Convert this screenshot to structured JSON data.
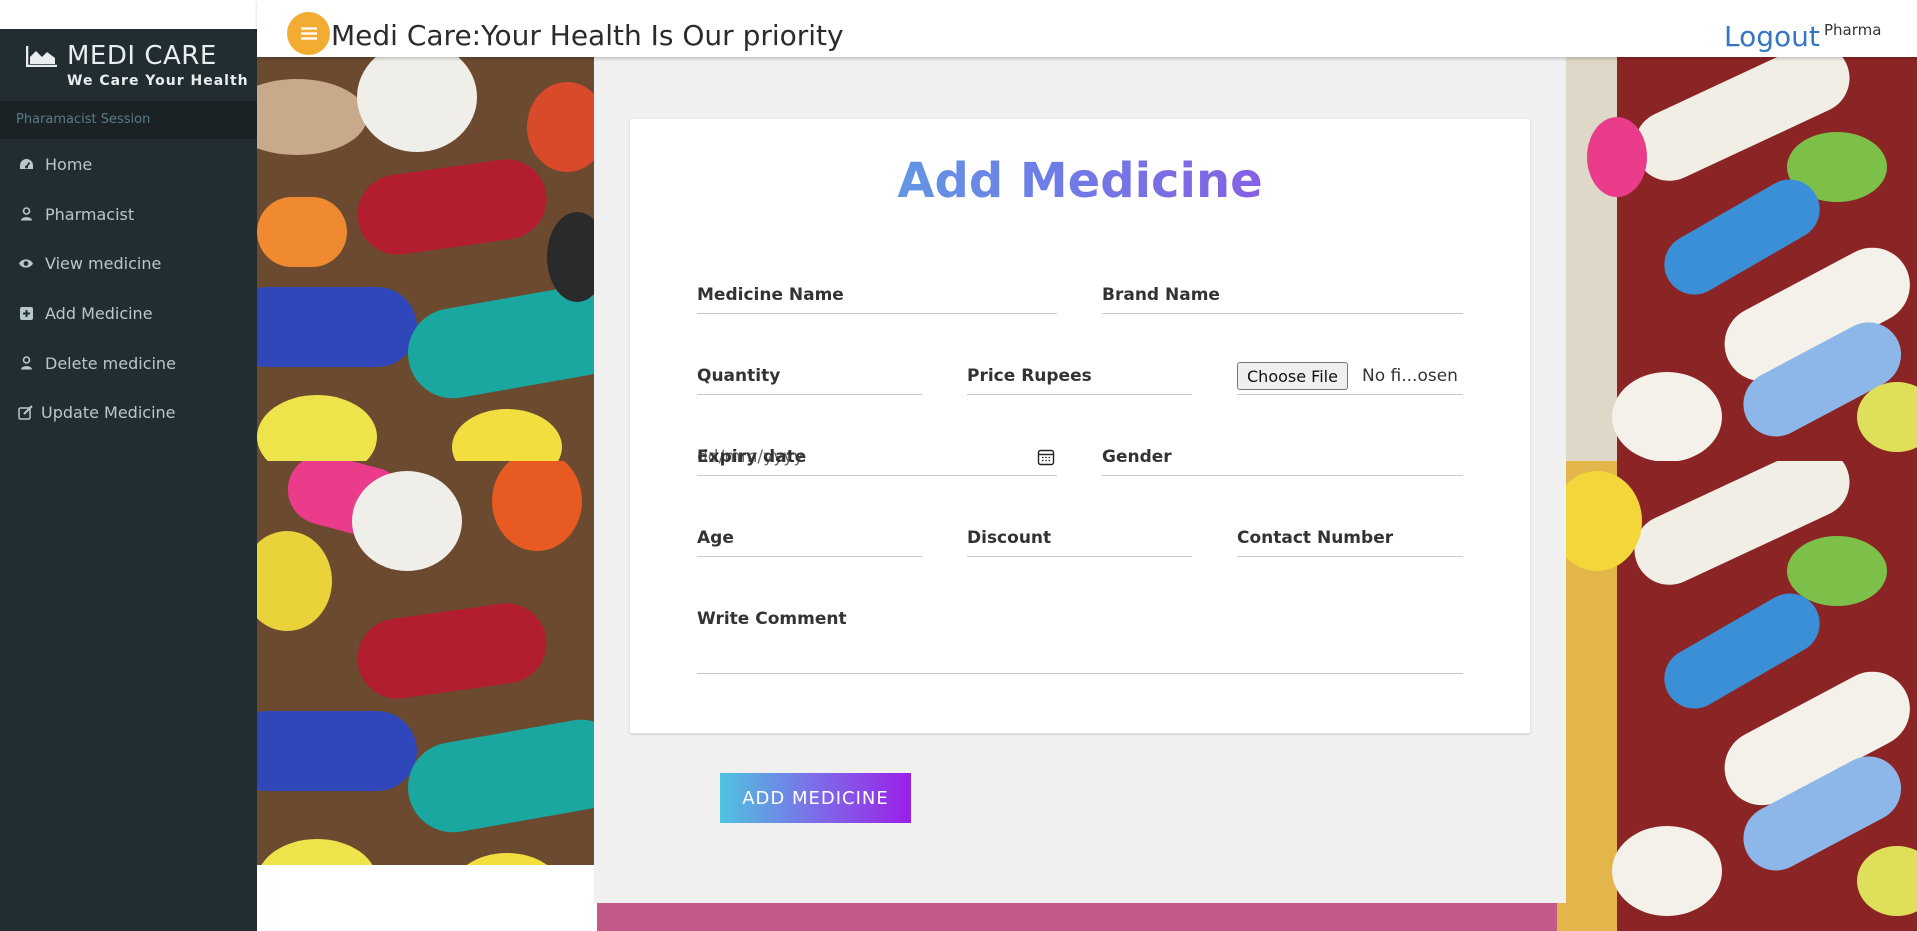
{
  "brand": {
    "name": "MEDI CARE",
    "tagline": "We Care Your Health"
  },
  "sidebar": {
    "session_label": "Pharamacist Session",
    "items": [
      {
        "label": "Home",
        "icon": "dashboard-icon"
      },
      {
        "label": "Pharmacist",
        "icon": "user-icon"
      },
      {
        "label": "View medicine",
        "icon": "eye-icon"
      },
      {
        "label": "Add Medicine",
        "icon": "plus-square-icon"
      },
      {
        "label": "Delete medicine",
        "icon": "user-icon"
      },
      {
        "label": "Update Medicine",
        "icon": "edit-icon"
      }
    ]
  },
  "header": {
    "title": "Medi Care:Your Health Is Our priority",
    "logout": "Logout",
    "user": "Pharma"
  },
  "form": {
    "title": "Add Medicine",
    "medicine_name": "Medicine Name",
    "brand_name": "Brand Name",
    "quantity": "Quantity",
    "price": "Price Rupees",
    "file_button": "Choose File",
    "file_status": "No fi...osen",
    "expiry_label": "Expiry date",
    "expiry_placeholder": "dd/mm/yyyy",
    "gender": "Gender",
    "age": "Age",
    "discount": "Discount",
    "contact": "Contact Number",
    "comment": "Write Comment",
    "submit": "ADD MEDICINE"
  },
  "colors": {
    "sidebar_bg": "#222d32",
    "menu_button": "#f3ac32",
    "logout_link": "#3577c4",
    "gradient_start": "#4fc3df",
    "gradient_end": "#9b1fe8"
  }
}
